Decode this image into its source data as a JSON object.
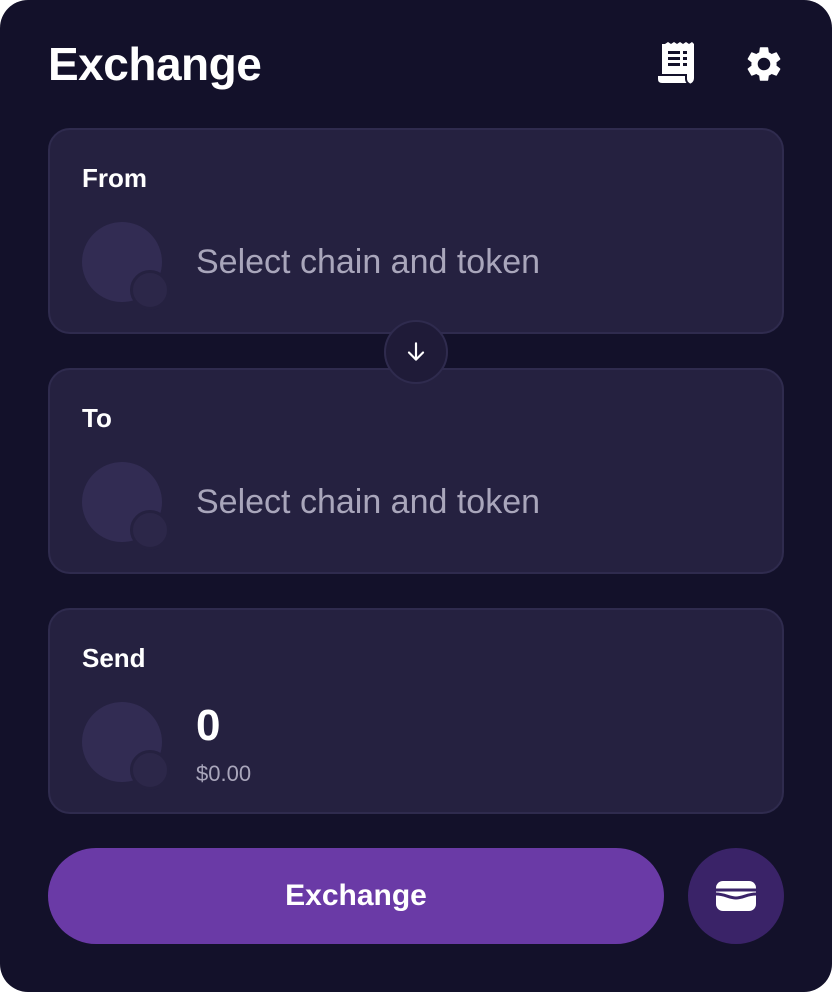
{
  "header": {
    "title": "Exchange",
    "history_icon": "receipt-icon",
    "settings_icon": "gear-icon"
  },
  "from": {
    "label": "From",
    "placeholder": "Select chain and token"
  },
  "swap": {
    "icon": "arrow-down-icon"
  },
  "to": {
    "label": "To",
    "placeholder": "Select chain and token"
  },
  "send": {
    "label": "Send",
    "amount": "0",
    "amount_usd": "$0.00"
  },
  "actions": {
    "exchange_label": "Exchange",
    "wallet_icon": "wallet-icon"
  },
  "colors": {
    "background": "#13112a",
    "card": "#252140",
    "accent": "#6a3aa6",
    "wallet_button": "#3a2368",
    "muted_text": "#a9a6bb"
  }
}
